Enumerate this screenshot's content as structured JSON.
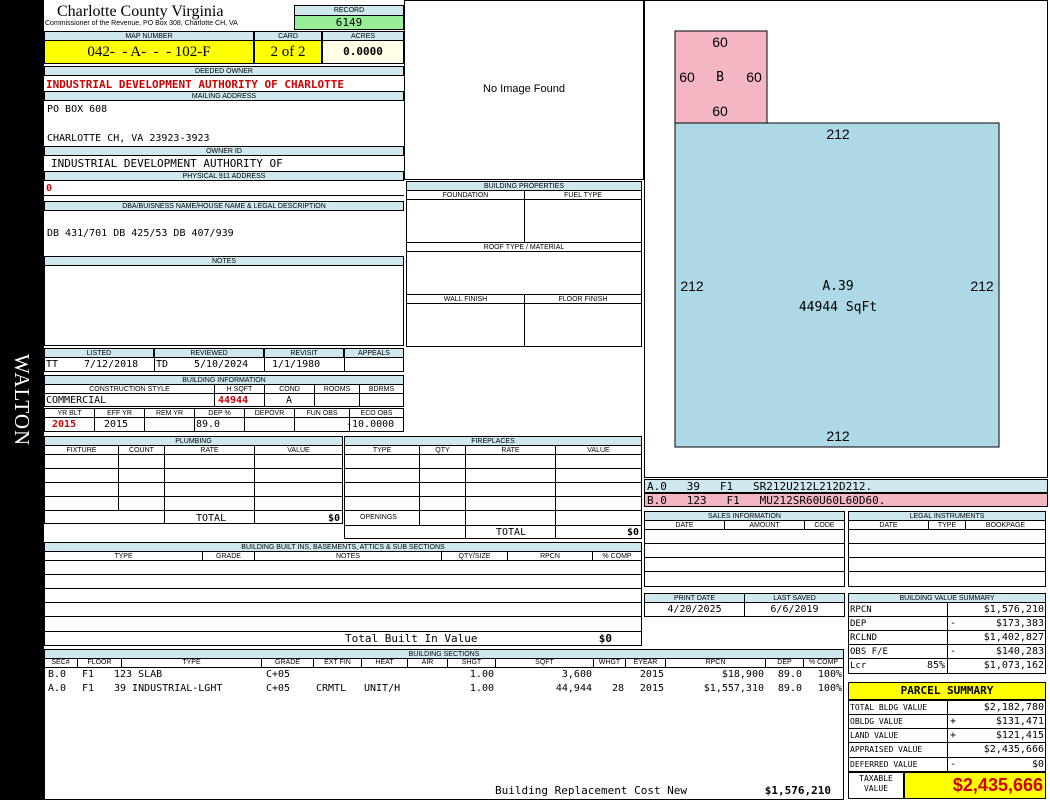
{
  "side_label": "WALTON",
  "header": {
    "county": "Charlotte County Virginia",
    "commissioner": "Commissioner of the Revenue, PO Box 308, Charlotte CH, VA",
    "record_label": "RECORD",
    "record": "6149",
    "map_label": "MAP NUMBER",
    "map_number": "042-  - A-  -  - 102-F",
    "card_label": "CARD",
    "card": "2 of 2",
    "acres_label": "ACRES",
    "acres": "0.0000"
  },
  "owner": {
    "deeded_label": "DEEDED OWNER",
    "deeded_owner": "INDUSTRIAL DEVELOPMENT AUTHORITY OF CHARLOTTE",
    "mailing_label": "MAILING ADDRESS",
    "mailing_line1": "PO BOX 608",
    "mailing_line2": "CHARLOTTE CH, VA 23923-3923",
    "owner_id_label": "OWNER ID",
    "owner_id": "INDUSTRIAL DEVELOPMENT AUTHORITY OF",
    "physical_label": "PHYSICAL 911 ADDRESS",
    "physical": "0",
    "dba_label": "DBA/BUISNESS NAME/HOUSE NAME & LEGAL DESCRIPTION",
    "dba": "DB 431/701 DB 425/53 DB 407/939",
    "notes_label": "NOTES"
  },
  "image": {
    "text": "No Image Found"
  },
  "building_properties": {
    "title": "BUILDING PROPERTIES",
    "foundation": "FOUNDATION",
    "fuel": "FUEL TYPE",
    "roof": "ROOF TYPE / MATERIAL",
    "wall": "WALL FINISH",
    "floor": "FLOOR FINISH"
  },
  "listing": {
    "listed_label": "LISTED",
    "reviewed_label": "REVIEWED",
    "revisit_label": "REVISIT",
    "appeals_label": "APPEALS",
    "listed_by": "TT",
    "listed": "7/12/2018",
    "reviewed_by": "TD",
    "reviewed": "5/10/2024",
    "revisit": "1/1/1980"
  },
  "building_info": {
    "title": "BUILDING INFORMATION",
    "style_label": "CONSTRUCTION STYLE",
    "hsqft_label": "H SQFT",
    "cond_label": "COND",
    "rooms_label": "ROOMS",
    "bdrms_label": "BDRMS",
    "style": "COMMERCIAL",
    "hsqft": "44944",
    "cond": "A",
    "yrblt_label": "YR BLT",
    "effyr_label": "EFF YR",
    "remyr_label": "REM YR",
    "dep_label": "DEP %",
    "depovr_label": "DEPOVR",
    "funobs_label": "FUN OBS",
    "ecoobs_label": "ECO OBS",
    "yrblt": "2015",
    "effyr": "2015",
    "dep": "89.0",
    "ecoobs": "-10.0000"
  },
  "plumbing": {
    "title": "PLUMBING",
    "fixture": "FIXTURE",
    "count": "COUNT",
    "rate": "RATE",
    "value": "VALUE",
    "total_label": "TOTAL",
    "total": "$0"
  },
  "fireplaces": {
    "title": "FIREPLACES",
    "type": "TYPE",
    "qty": "QTY",
    "rate": "RATE",
    "value": "VALUE",
    "openings": "OPENINGS",
    "total_label": "TOTAL",
    "total": "$0"
  },
  "built_ins": {
    "title": "BUILDING BUILT INS, BASEMENTS, ATTICS & SUB SECTIONS",
    "type": "TYPE",
    "grade": "GRADE",
    "notes": "NOTES",
    "qty": "QTY/SIZE",
    "rpcn": "RPCN",
    "comp": "% COMP",
    "total_label": "Total Built In Value",
    "total": "$0"
  },
  "sections": {
    "title": "BUILDING SECTIONS",
    "headers": [
      "SEC#",
      "FLOOR",
      "TYPE",
      "GRADE",
      "EXT FIN",
      "HEAT",
      "AIR",
      "SHGT",
      "SQFT",
      "WHGT",
      "EYEAR",
      "RPCN",
      "DEP",
      "% COMP"
    ],
    "rows": [
      [
        "B.0",
        "F1",
        "123 SLAB",
        "C+05",
        "",
        "",
        "",
        "1.00",
        "3,600",
        "",
        "2015",
        "$18,900",
        "89.0",
        "100%"
      ],
      [
        "A.0",
        "F1",
        "39 INDUSTRIAL-LGHT",
        "C+05",
        "CRMTL",
        "UNIT/H",
        "",
        "1.00",
        "44,944",
        "28",
        "2015",
        "$1,557,310",
        "89.0",
        "100%"
      ]
    ],
    "replacement_label": "Building Replacement Cost New",
    "replacement": "$1,576,210"
  },
  "sketch": {
    "b_label": "B",
    "b_top": "60",
    "b_left": "60",
    "b_right": "60",
    "b_bottom": "60",
    "a_label": "A.39",
    "a_sqft": "44944 SqFt",
    "a_top": "212",
    "a_left": "212",
    "a_right": "212",
    "a_bottom": "212",
    "fill_a": "#add8e6",
    "fill_b": "#f4b6c2"
  },
  "sketch_legend": [
    "A.0   39   F1   SR212U212L212D212.",
    "B.0   123   F1   MU212SR60U60L60D60."
  ],
  "sales": {
    "title": "SALES INFORMATION",
    "date": "DATE",
    "amount": "AMOUNT",
    "code": "CODE"
  },
  "legal": {
    "title": "LEGAL INSTRUMENTS",
    "date": "DATE",
    "type": "TYPE",
    "bookpage": "BOOKPAGE"
  },
  "print": {
    "print_label": "PRINT DATE",
    "saved_label": "LAST SAVED",
    "print_date": "4/20/2025",
    "last_saved": "6/6/2019"
  },
  "value_summary": {
    "title": "BUILDING VALUE SUMMARY",
    "rpcn_label": "RPCN",
    "rpcn": "$1,576,210",
    "dep_label": "DEP",
    "dep_sign": "-",
    "dep": "$173,383",
    "rclnd_label": "RCLND",
    "rclnd": "$1,402,827",
    "obs_label": "OBS F/E",
    "obs_sign": "-",
    "obs": "$140,283",
    "lcr_label": "Lcr",
    "lcr_pct": "85%",
    "lcr": "$1,073,162"
  },
  "parcel": {
    "title": "PARCEL SUMMARY",
    "bldg_label": "TOTAL BLDG VALUE",
    "bldg": "$2,182,780",
    "obldg_label": "OBLDG VALUE",
    "obldg_sign": "+",
    "obldg": "$131,471",
    "land_label": "LAND VALUE",
    "land_sign": "+",
    "land": "$121,415",
    "appraised_label": "APPRAISED VALUE",
    "appraised": "$2,435,666",
    "deferred_label": "DEFERRED VALUE",
    "deferred_sign": "-",
    "deferred": "$0",
    "taxable_label1": "TAXABLE",
    "taxable_label2": "VALUE",
    "taxable": "$2,435,666"
  },
  "colors": {
    "header_bg": "#cfe8ef",
    "yellow": "#ffff00",
    "green": "#99ee99",
    "red": "#d00000"
  }
}
